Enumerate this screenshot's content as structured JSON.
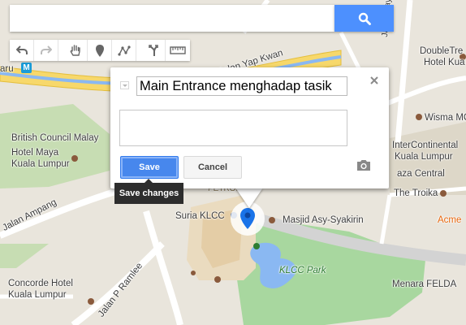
{
  "search": {
    "value": "",
    "placeholder": ""
  },
  "toolbar": {
    "icons": [
      "undo-icon",
      "redo-icon",
      "hand-pan-icon",
      "add-marker-icon",
      "draw-line-icon",
      "directions-icon",
      "ruler-icon"
    ]
  },
  "info_window": {
    "title_value": "Main Entrance menghadap tasik",
    "description_value": "",
    "save_label": "Save",
    "cancel_label": "Cancel",
    "save_tooltip": "Save changes"
  },
  "map": {
    "labels": {
      "aru": "aru",
      "jalan_yap_kwan": "Jalan Yap Kwan",
      "jalan_mayang_sari": "Jalan Mayang Sari",
      "doubletree_1": "DoubleTre",
      "doubletree_2": "Hotel Kua",
      "wisma": "Wisma MC",
      "british_council": "British Council Malay",
      "hotel_maya_1": "Hotel Maya",
      "hotel_maya_2": "Kuala Lumpur",
      "intercontinental_1": "InterContinental",
      "intercontinental_2": "Kuala Lumpur",
      "plaza_central": "aza Central",
      "jalan_ampang": "Jalan Ampang",
      "petronas": "PETRONAS",
      "the_troika": "The Troika",
      "suria_klcc": "Suria KLCC",
      "masjid": "Masjid Asy-Syakirin",
      "acme": "Acme",
      "klcc_park": "KLCC Park",
      "concorde_1": "Concorde Hotel",
      "concorde_2": "Kuala Lumpur",
      "jalan_p_ramlee": "Jalan P Ramlee",
      "menara_felda": "Menara FELDA",
      "transit_m": "M"
    }
  },
  "colors": {
    "accent": "#4d90fe",
    "save": "#4787ed",
    "marker": "#1a73e8",
    "park": "#a8d79f",
    "highway": "#f7d86b",
    "water": "#8ab8f2"
  }
}
